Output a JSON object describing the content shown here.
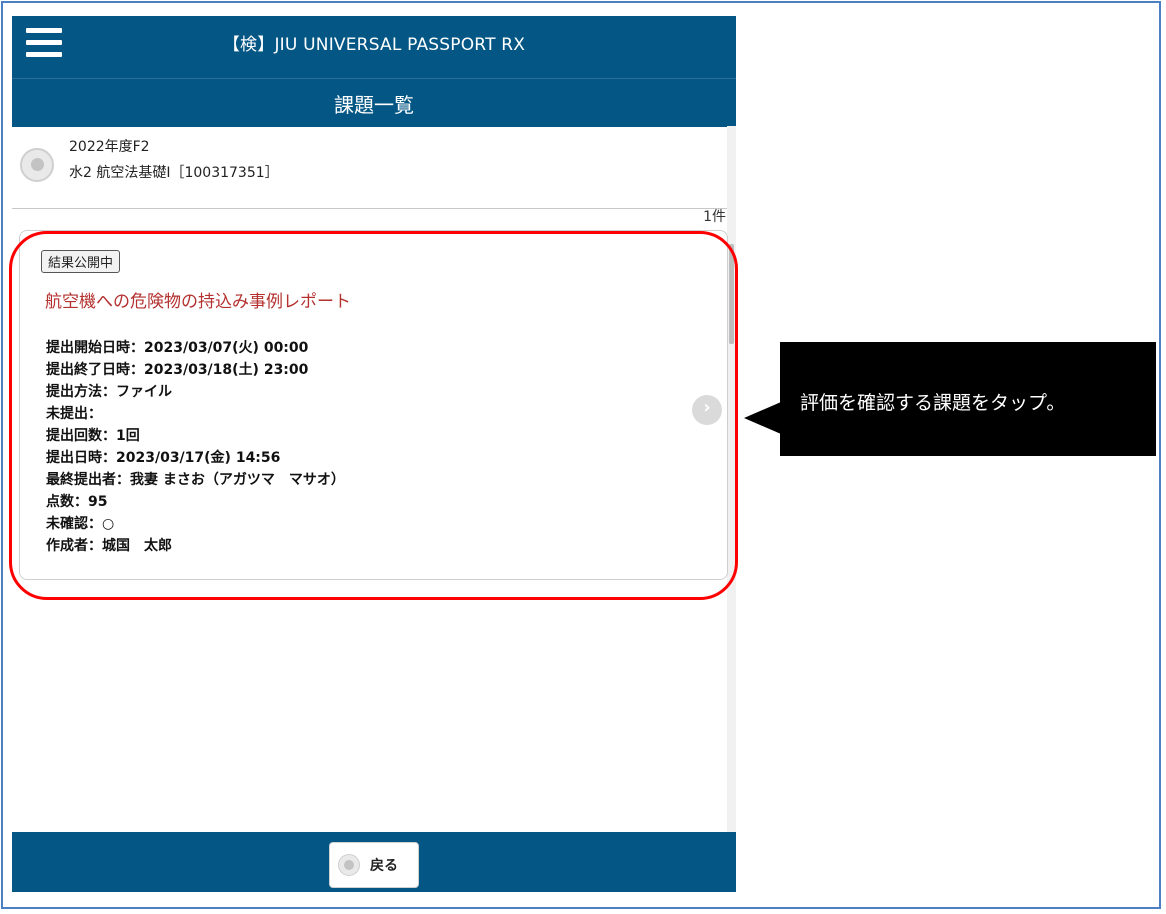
{
  "app": {
    "title": "【検】JIU UNIVERSAL PASSPORT RX"
  },
  "page": {
    "title": "課題一覧"
  },
  "course": {
    "year": "2022年度F2",
    "name": "水2 航空法基礎I［100317351］"
  },
  "list": {
    "count": "1件"
  },
  "assignment": {
    "status": "結果公開中",
    "title": "航空機への危険物の持込み事例レポート",
    "details": [
      "提出開始日時：2023/03/07(火) 00:00",
      "提出終了日時：2023/03/18(土) 23:00",
      "提出方法：ファイル",
      "未提出：",
      "提出回数：1回",
      "提出日時：2023/03/17(金) 14:56",
      "最終提出者：我妻 まさお（アガツマ　マサオ）",
      "点数：95",
      "未確認：○",
      "作成者：城国　太郎"
    ]
  },
  "footer": {
    "back_label": "戻る"
  },
  "callout": {
    "text": "評価を確認する課題をタップ。"
  },
  "icons": {
    "menu": "hamburger-icon",
    "back": "back-circle-icon",
    "chevron": "chevron-right-icon"
  },
  "colors": {
    "header": "#045785",
    "highlight": "#ff0000",
    "title": "#b3312f"
  }
}
